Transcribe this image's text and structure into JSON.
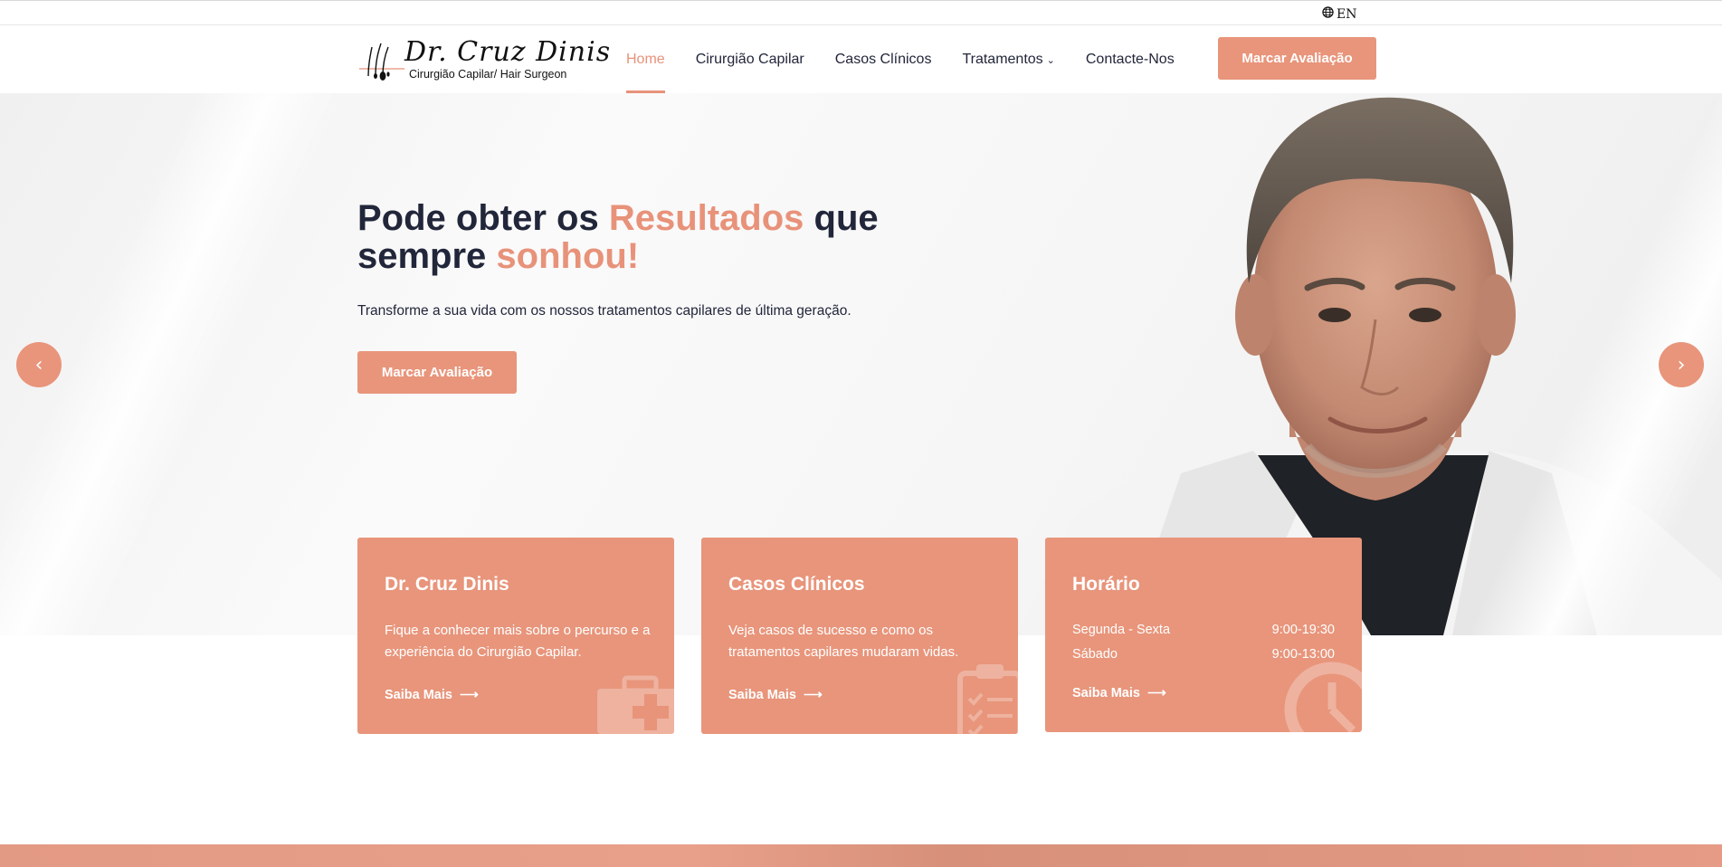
{
  "topbar": {
    "language": "EN",
    "icon": "globe-icon"
  },
  "header": {
    "logo": {
      "script": "Dr. Cruz Dinis",
      "subtitle": "Cirurgião Capilar/ Hair Surgeon"
    },
    "nav": [
      {
        "label": "Home",
        "active": true
      },
      {
        "label": "Cirurgião Capilar",
        "active": false
      },
      {
        "label": "Casos Clínicos",
        "active": false
      },
      {
        "label": "Tratamentos",
        "active": false,
        "dropdown": true
      },
      {
        "label": "Contacte-Nos",
        "active": false
      }
    ],
    "cta_label": "Marcar Avaliação"
  },
  "hero": {
    "title_part1": "Pode obter os ",
    "title_accent1": "Resultados",
    "title_part2": " que sempre ",
    "title_accent2": "sonhou!",
    "subtitle": "Transforme a sua vida com os nossos tratamentos capilares de última geração.",
    "cta_label": "Marcar Avaliação",
    "prev_icon": "chevron-left-icon",
    "next_icon": "chevron-right-icon"
  },
  "cards": [
    {
      "title": "Dr. Cruz Dinis",
      "text": "Fique a conhecer mais sobre o percurso e a experiência do Cirurgião Capilar.",
      "link": "Saiba Mais",
      "icon": "medical-kit-icon"
    },
    {
      "title": "Casos Clínicos",
      "text": "Veja casos de sucesso e como os tratamentos capilares mudaram vidas.",
      "link": "Saiba Mais",
      "icon": "clipboard-icon"
    },
    {
      "title": "Horário",
      "hours": [
        {
          "days": "Segunda - Sexta",
          "time": "9:00-19:30"
        },
        {
          "days": "Sábado",
          "time": "9:00-13:00"
        }
      ],
      "link": "Saiba Mais",
      "icon": "clock-icon"
    }
  ],
  "colors": {
    "accent": "#e8957b",
    "text": "#22263a"
  }
}
